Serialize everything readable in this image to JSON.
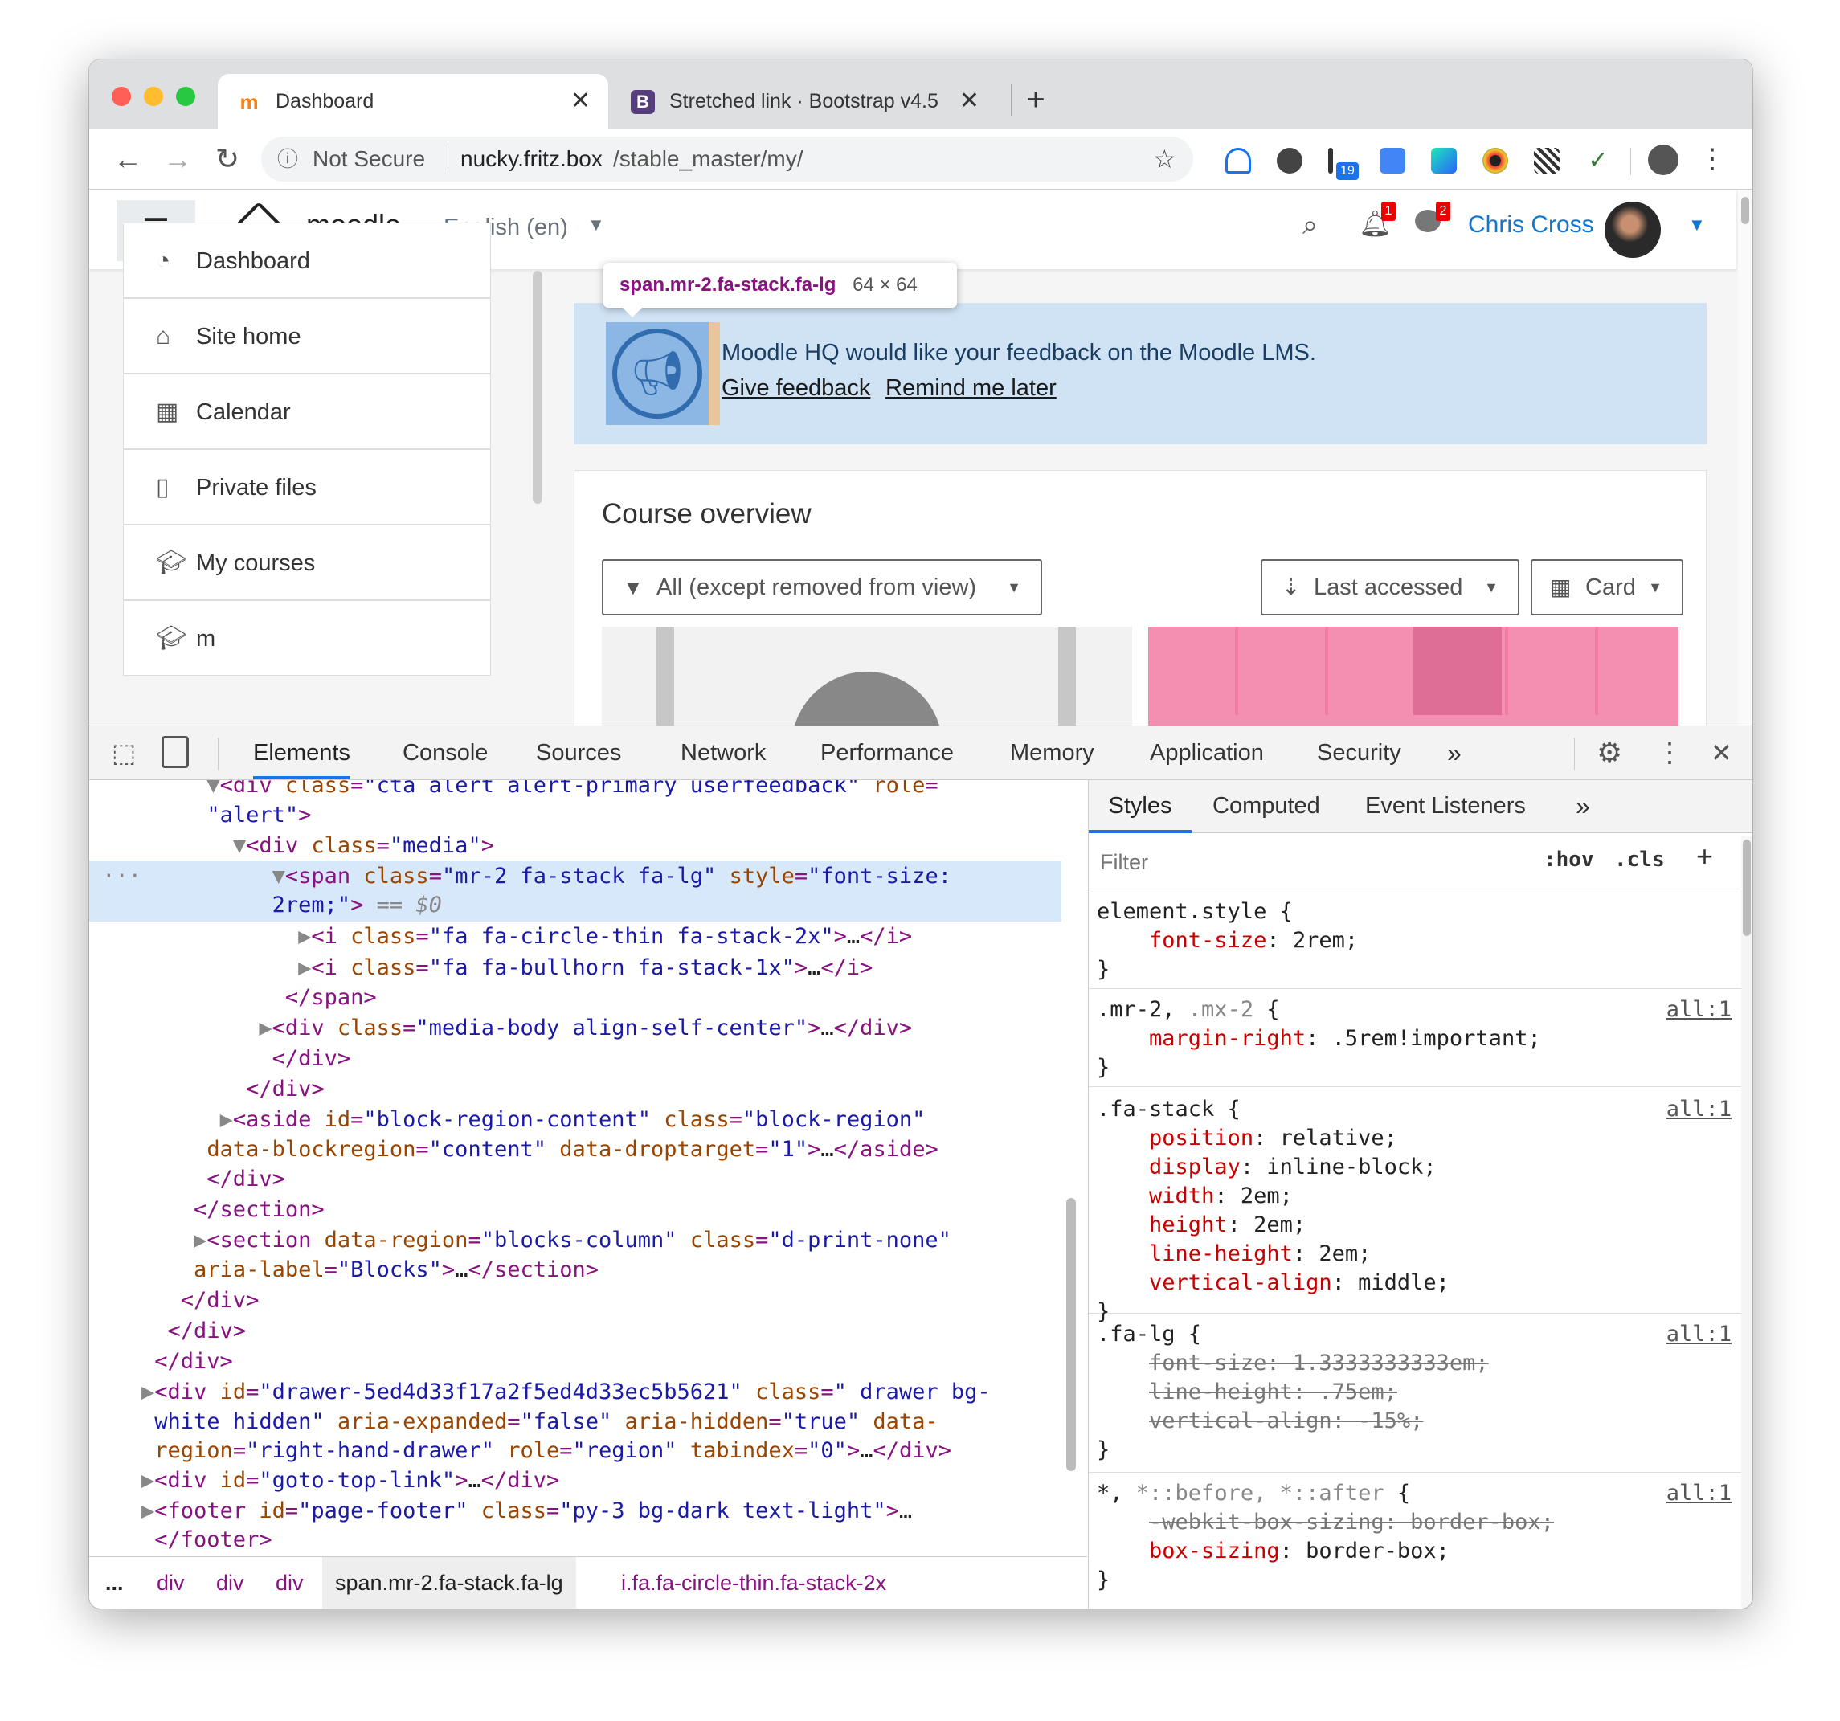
{
  "tabs": [
    {
      "title": "Dashboard",
      "icon": "moodle-favicon-icon"
    },
    {
      "title": "Stretched link · Bootstrap v4.5",
      "icon": "bootstrap-favicon-icon"
    }
  ],
  "toolbar": {
    "security": "Not Secure",
    "url_host": "nucky.fritz.box",
    "url_path": "/stable_master/my/",
    "badge_ext": "19"
  },
  "moodle": {
    "brand": "moodle",
    "language": "English (en)",
    "notif_count": "1",
    "msg_count": "2",
    "user_name": "Chris Cross",
    "nav": [
      {
        "label": "Dashboard",
        "icon": "dashboard-icon"
      },
      {
        "label": "Site home",
        "icon": "home-icon"
      },
      {
        "label": "Calendar",
        "icon": "calendar-icon"
      },
      {
        "label": "Private files",
        "icon": "file-icon"
      },
      {
        "label": "My courses",
        "icon": "graduation-cap-icon"
      },
      {
        "label": "m",
        "icon": "graduation-cap-icon"
      }
    ],
    "alert_text": "Moodle HQ would like your feedback on the Moodle LMS.",
    "give_feedback": "Give feedback",
    "remind_later": "Remind me later",
    "course_overview_title": "Course overview",
    "filter_label": "All (except removed from view)",
    "sort_label": "Last accessed",
    "view_label": "Card"
  },
  "tooltip": {
    "selector": "span.mr-2.fa-stack.fa-lg",
    "size": "64 × 64"
  },
  "devtools": {
    "tabs": [
      "Elements",
      "Console",
      "Sources",
      "Network",
      "Performance",
      "Memory",
      "Application",
      "Security"
    ],
    "style_tabs": [
      "Styles",
      "Computed",
      "Event Listeners"
    ],
    "filter_placeholder": "Filter",
    "hov": ":hov",
    "cls": ".cls",
    "crumbs": [
      "...",
      "div",
      "div",
      "div",
      "span.mr-2.fa-stack.fa-lg",
      "i.fa.fa-circle-thin.fa-stack-2x"
    ]
  },
  "colors": {
    "accent": "#1177d1",
    "alert_bg": "#cfe3f5",
    "tag": "#881280",
    "attr_name": "#994500",
    "attr_value": "#1a1aa6",
    "css_prop": "#c80000",
    "card_pink": "#f48fb1"
  }
}
